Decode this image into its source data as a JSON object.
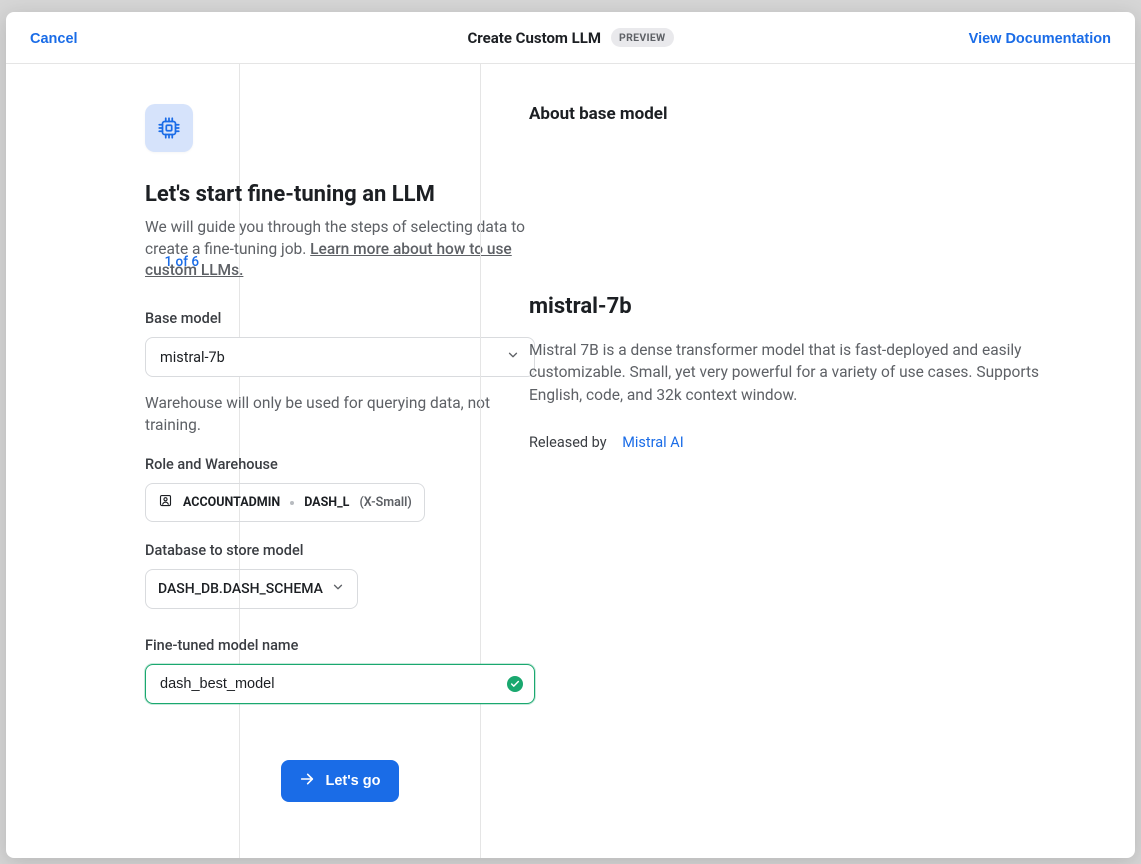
{
  "header": {
    "cancel": "Cancel",
    "title": "Create Custom LLM",
    "badge": "PREVIEW",
    "docs": "View Documentation"
  },
  "step": "1 of 6",
  "main": {
    "heading": "Let's start fine-tuning an LLM",
    "sub_pre": "We will guide you through the steps of selecting data to create a fine-tuning job. ",
    "learn": "Learn more about how to use custom LLMs.",
    "base_label": "Base model",
    "base_value": "mistral-7b",
    "warehouse_helper": "Warehouse will only be used for querying data, not training.",
    "role_label": "Role and Warehouse",
    "role_value": "ACCOUNTADMIN",
    "warehouse_value": "DASH_L",
    "warehouse_size": "(X-Small)",
    "db_label": "Database to store model",
    "db_value": "DASH_DB.DASH_SCHEMA",
    "name_label": "Fine-tuned model name",
    "name_value": "dash_best_model",
    "cta": "Let's go"
  },
  "about": {
    "heading": "About base model",
    "model": "mistral-7b",
    "desc": "Mistral 7B is a dense transformer model that is fast-deployed and easily customizable. Small, yet very powerful for a variety of use cases. Supports English, code, and 32k context window.",
    "released_label": "Released by",
    "released_by": "Mistral AI"
  }
}
